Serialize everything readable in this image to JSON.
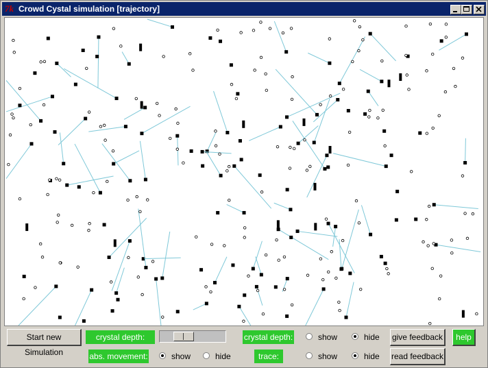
{
  "window": {
    "title": "Crowd Cystal simulation [trajectory]",
    "icon": "tk-icon",
    "title_bar_color": "#0a246a",
    "controls": [
      "minimize-icon",
      "maximize-icon",
      "close-icon"
    ]
  },
  "canvas": {
    "background": "#ffffff",
    "trace_color": "#7ec8d8",
    "agent_color": "#000000",
    "description_icon": "simulation-canvas"
  },
  "controls": {
    "start_button": "Start new Simulation",
    "crystal_depth_slider_label": "crystal depth:",
    "crystal_depth_level": 0.3,
    "abs_movement_label": "abs. movement:",
    "abs_movement_options": [
      {
        "label": "show",
        "selected": true
      },
      {
        "label": "hide",
        "selected": false
      }
    ],
    "crystal_depth_toggle_label": "crystal depth:",
    "crystal_depth_options": [
      {
        "label": "show",
        "selected": false
      },
      {
        "label": "hide",
        "selected": true
      }
    ],
    "trace_label": "trace:",
    "trace_options": [
      {
        "label": "show",
        "selected": false
      },
      {
        "label": "hide",
        "selected": true
      }
    ],
    "give_feedback_button": "give feedback",
    "read_feedback_button": "read feedback",
    "help_button": "help",
    "label_color": "#2ec82e"
  }
}
